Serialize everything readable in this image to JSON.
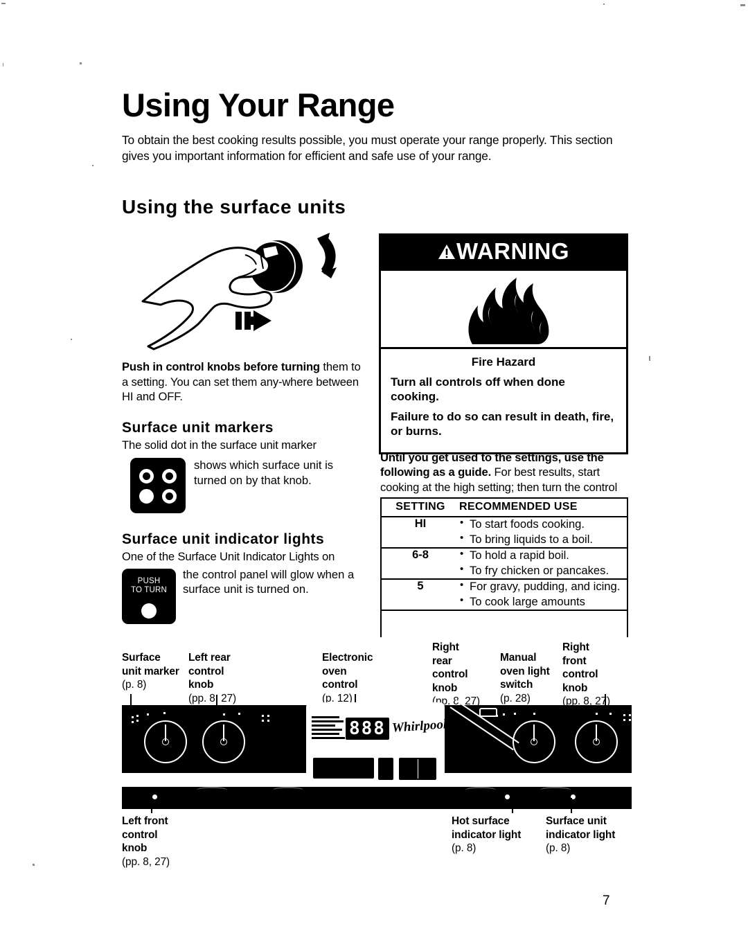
{
  "page": {
    "title": "Using Your Range",
    "intro": "To obtain the best cooking results possible, you must operate your range properly. This section gives you important information for efficient and safe use of your range.",
    "page_number": "7"
  },
  "section": {
    "heading": "Using the surface units"
  },
  "left_column": {
    "push_lead": "Push in control knobs before turning",
    "push_rest": " them to a setting. You can set them any-where between HI and OFF.",
    "markers_heading": "Surface unit markers",
    "markers_intro": "The solid dot in the surface unit marker",
    "markers_text": "shows which surface unit is turned on by that knob.",
    "indicator_heading": "Surface unit indicator lights",
    "indicator_intro": "One of the Surface Unit Indicator Lights on",
    "indicator_text": "the control panel will glow when a surface unit is turned on.",
    "push_to_turn_line1": "PUSH",
    "push_to_turn_line2": "TO TURN"
  },
  "warning": {
    "banner": "WARNING",
    "title": "Fire Hazard",
    "line1": "Turn all controls off when done cooking.",
    "line2": "Failure to do so can result in death, fire, or burns."
  },
  "guide": {
    "lead": "Until you get used to the settings, use the following as a guide.",
    "rest": " For best results, start cooking at the high setting; then turn the control knob down to continue cooking."
  },
  "settings_table": {
    "headers": [
      "SETTING",
      "RECOMMENDED USE"
    ],
    "rows": [
      {
        "setting": "HI",
        "uses": [
          "To start foods cooking.",
          "To bring liquids to a boil."
        ]
      },
      {
        "setting": "6-8",
        "uses": [
          "To hold a rapid boil.",
          "To fry chicken or pancakes."
        ]
      },
      {
        "setting": "5",
        "uses": [
          "For gravy, pudding, and icing.",
          "To cook large amounts"
        ]
      }
    ]
  },
  "callouts": {
    "surface_unit_marker": {
      "label": "Surface\nunit marker",
      "page_ref": "(p. 8)"
    },
    "left_rear_knob": {
      "label": "Left rear\ncontrol\nknob",
      "page_ref": "(pp. 8, 27)"
    },
    "electronic_oven_control": {
      "label": "Electronic\noven\ncontrol",
      "page_ref": "(p. 12)"
    },
    "right_rear_knob": {
      "label": "Right\nrear\ncontrol\nknob",
      "page_ref": "(pp. 8, 27)"
    },
    "manual_oven_light_switch": {
      "label": "Manual\noven light\nswitch",
      "page_ref": "(p. 28)"
    },
    "right_front_knob": {
      "label": "Right\nfront\ncontrol\nknob",
      "page_ref": "(pp. 8, 27)"
    },
    "left_front_knob": {
      "label": "Left front\ncontrol\nknob",
      "page_ref": "(pp. 8, 27)"
    },
    "hot_surface_indicator": {
      "label": "Hot surface\nindicator light",
      "page_ref": "(p. 8)"
    },
    "surface_unit_indicator": {
      "label": "Surface unit\nindicator light",
      "page_ref": "(p. 8)"
    }
  },
  "range_panel": {
    "display_value": "888",
    "brand": "Whirlpool"
  }
}
